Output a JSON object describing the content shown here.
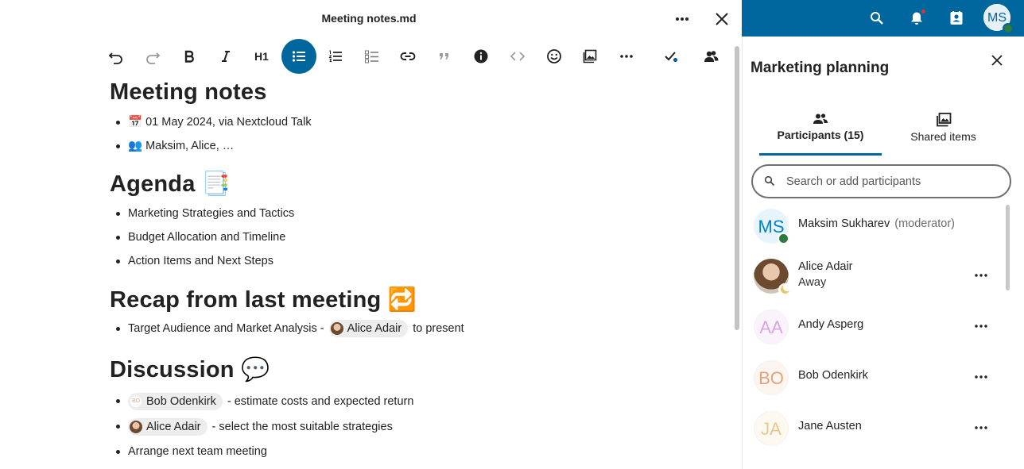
{
  "editor": {
    "file_title": "Meeting notes.md",
    "toolbar": [
      {
        "name": "undo-button",
        "icon": "undo-icon"
      },
      {
        "name": "redo-button",
        "icon": "redo-icon"
      },
      {
        "name": "bold-button",
        "icon": "bold-icon"
      },
      {
        "name": "italic-button",
        "icon": "italic-icon"
      },
      {
        "name": "heading-button",
        "label": "H1"
      },
      {
        "name": "bullet-list-button",
        "icon": "bullet-list-icon",
        "active": true
      },
      {
        "name": "ordered-list-button",
        "icon": "ordered-list-icon"
      },
      {
        "name": "task-list-button",
        "icon": "task-list-icon"
      },
      {
        "name": "link-button",
        "icon": "link-icon"
      },
      {
        "name": "blockquote-button",
        "icon": "quote-icon"
      },
      {
        "name": "callout-button",
        "icon": "info-icon"
      },
      {
        "name": "code-button",
        "icon": "code-icon"
      },
      {
        "name": "emoji-button",
        "icon": "emoji-icon"
      },
      {
        "name": "image-button",
        "icon": "image-icon"
      },
      {
        "name": "more-formatting-button",
        "icon": "more-icon"
      },
      {
        "name": "saved-status-button",
        "icon": "check-icon"
      },
      {
        "name": "sessions-button",
        "icon": "users-icon"
      }
    ],
    "sections": {
      "title": "Meeting notes",
      "meta": [
        "📅 01 May 2024, via Nextcloud Talk",
        "👥 Maksim, Alice, …"
      ],
      "agenda_heading": "Agenda 📑",
      "agenda": [
        "Marketing Strategies and Tactics",
        "Budget Allocation and Timeline",
        "Action Items and Next Steps"
      ],
      "recap_heading": "Recap from last meeting 🔁",
      "recap_item": {
        "prefix": "Target Audience and Market Analysis - ",
        "mention": "Alice Adair",
        "suffix": " to present"
      },
      "discussion_heading": "Discussion 💬",
      "discussion": [
        {
          "mention": "Bob Odenkirk",
          "mention_initials": "BO",
          "suffix": " - estimate costs and expected return"
        },
        {
          "mention": "Alice Adair",
          "suffix": " - select the most suitable strategies"
        },
        {
          "text": "Arrange next team meeting"
        }
      ]
    }
  },
  "header": {
    "icons": [
      "search-icon",
      "notifications-icon",
      "contacts-icon"
    ],
    "user_initials": "MS"
  },
  "sidebar": {
    "title": "Marketing planning",
    "tabs": [
      {
        "label": "Participants (15)",
        "icon": "participants-icon",
        "active": true
      },
      {
        "label": "Shared items",
        "icon": "shared-items-icon"
      }
    ],
    "search": {
      "placeholder": "Search or add participants",
      "value": ""
    },
    "participants": [
      {
        "name": "Maksim Sukharev",
        "role": "(moderator)",
        "initials": "MS",
        "color": "#0082c9",
        "status": "online"
      },
      {
        "name": "Alice Adair",
        "status_text": "Away",
        "status": "away",
        "photo": true
      },
      {
        "name": "Andy Asperg",
        "initials": "AA",
        "color": "#d9a4e0"
      },
      {
        "name": "Bob Odenkirk",
        "initials": "BO",
        "color": "#e6a37a"
      },
      {
        "name": "Jane Austen",
        "initials": "JA",
        "color": "#e8c98a"
      }
    ]
  },
  "colors": {
    "primary": "#00679e",
    "online": "#2d7b41",
    "text": "#222222"
  }
}
